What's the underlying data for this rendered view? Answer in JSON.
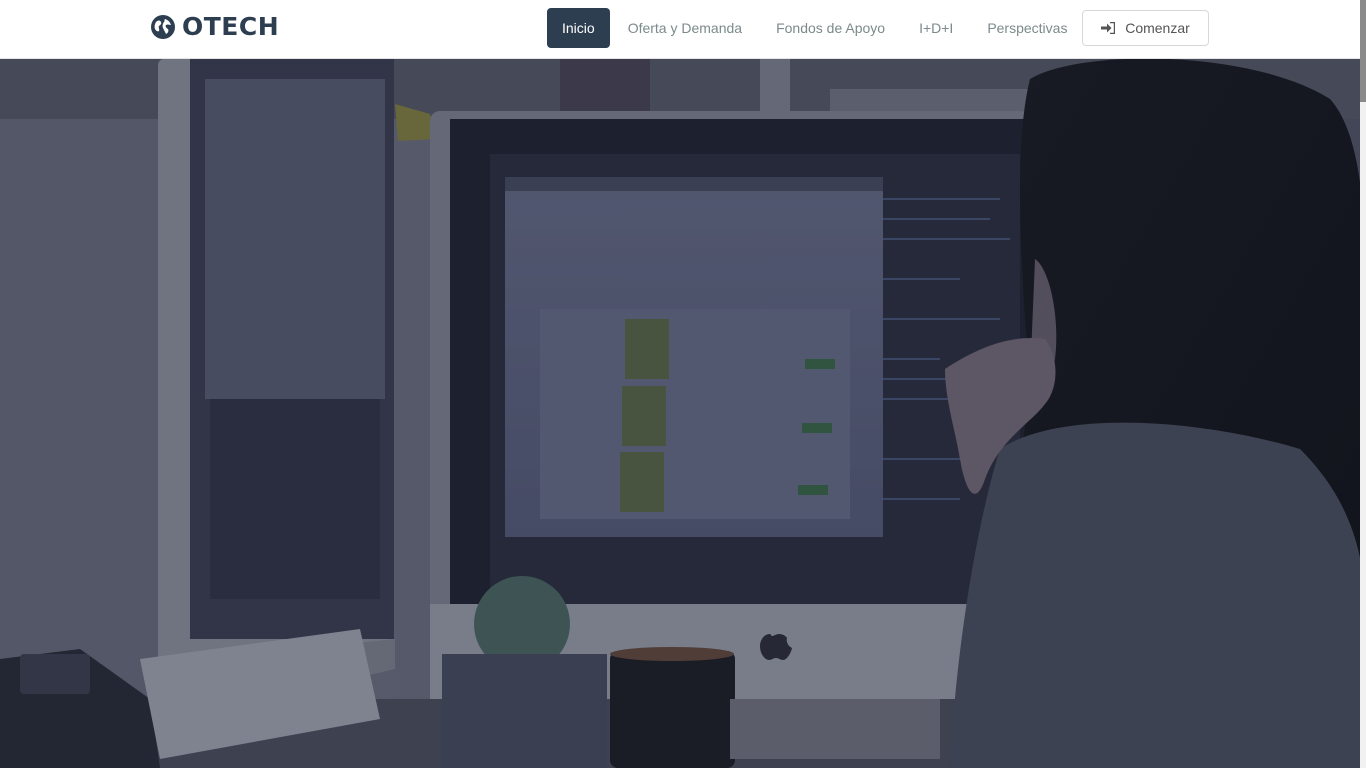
{
  "brand": {
    "name": "OTECH",
    "icon": "globe-icon"
  },
  "nav": {
    "items": [
      {
        "label": "Inicio",
        "active": true
      },
      {
        "label": "Oferta y Demanda",
        "active": false
      },
      {
        "label": "Fondos de Apoyo",
        "active": false
      },
      {
        "label": "I+D+I",
        "active": false
      },
      {
        "label": "Perspectivas",
        "active": false
      }
    ],
    "cta": {
      "label": "Comenzar",
      "icon": "sign-in-icon"
    }
  },
  "hero": {
    "image": "woman-at-computer-photo",
    "overlay_color": "#2c3e50"
  },
  "colors": {
    "primary": "#2c3e50",
    "nav_text": "#7b8a8b",
    "navbar_bg": "#ffffff"
  }
}
